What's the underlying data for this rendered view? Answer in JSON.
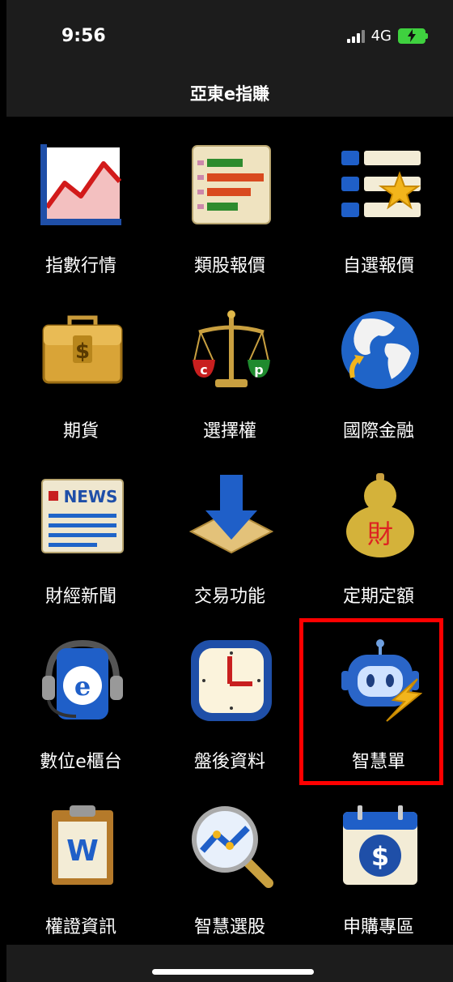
{
  "status_bar": {
    "time": "9:56",
    "network": "4G"
  },
  "header": {
    "title": "亞東e指賺"
  },
  "menu": [
    {
      "label": "指數行情",
      "icon": "index-chart-icon"
    },
    {
      "label": "類股報價",
      "icon": "sector-quote-icon"
    },
    {
      "label": "自選報價",
      "icon": "watchlist-icon"
    },
    {
      "label": "期貨",
      "icon": "futures-briefcase-icon"
    },
    {
      "label": "選擇權",
      "icon": "options-scale-icon"
    },
    {
      "label": "國際金融",
      "icon": "globe-icon"
    },
    {
      "label": "財經新聞",
      "icon": "news-icon"
    },
    {
      "label": "交易功能",
      "icon": "trade-download-icon"
    },
    {
      "label": "定期定額",
      "icon": "gourd-icon"
    },
    {
      "label": "數位e櫃台",
      "icon": "headset-e-icon"
    },
    {
      "label": "盤後資料",
      "icon": "clock-icon"
    },
    {
      "label": "智慧單",
      "icon": "robot-icon"
    },
    {
      "label": "權證資訊",
      "icon": "warrant-clipboard-icon"
    },
    {
      "label": "智慧選股",
      "icon": "magnifier-icon"
    },
    {
      "label": "申購專區",
      "icon": "calendar-dollar-icon"
    }
  ],
  "highlighted_item": "智慧單",
  "icon_text": {
    "news": "NEWS",
    "call": "c",
    "put": "p",
    "wealth": "財",
    "e": "e",
    "warrant": "W",
    "dollar": "$"
  }
}
